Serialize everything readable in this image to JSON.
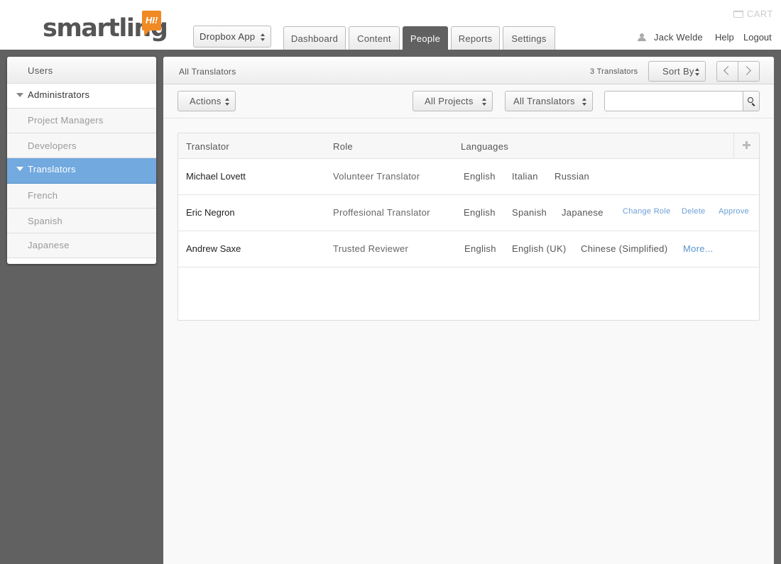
{
  "header": {
    "logo_text": "smartling",
    "logo_bubble": "HI!",
    "app_select": "Dropbox App",
    "tabs": [
      {
        "label": "Dashboard",
        "active": false
      },
      {
        "label": "Content",
        "active": false
      },
      {
        "label": "People",
        "active": true
      },
      {
        "label": "Reports",
        "active": false
      },
      {
        "label": "Settings",
        "active": false
      }
    ],
    "cart": "CART",
    "user_name": "Jack Welde",
    "help": "Help",
    "logout": "Logout"
  },
  "sidebar": {
    "items": [
      {
        "label": "Users"
      },
      {
        "label": "Administrators"
      },
      {
        "label": "Project Managers"
      },
      {
        "label": "Developers"
      },
      {
        "label": "Translators",
        "selected": true
      },
      {
        "label": "French"
      },
      {
        "label": "Spanish"
      },
      {
        "label": "Japanese"
      }
    ]
  },
  "main": {
    "title": "All Translators",
    "count": "3 Translators",
    "sort_by": "Sort By",
    "toolbar": {
      "actions": "Actions",
      "projects": "All Projects",
      "translators": "All Translators",
      "search_value": ""
    },
    "table": {
      "headers": [
        "Translator",
        "Role",
        "Languages"
      ],
      "rows": [
        {
          "name": "Michael Lovett",
          "role": "Volunteer Translator",
          "languages": [
            "English",
            "Italian",
            "Russian"
          ]
        },
        {
          "name": "Eric Negron",
          "role": "Proffesional Translator",
          "languages": [
            "English",
            "Spanish",
            "Japanese"
          ],
          "actions": [
            "Change Role",
            "Delete",
            "Approve"
          ]
        },
        {
          "name": "Andrew Saxe",
          "role": "Trusted Reviewer",
          "languages": [
            "English",
            "English (UK)",
            "Chinese (Simplified)"
          ],
          "more": "More..."
        }
      ]
    }
  },
  "colors": {
    "accent": "#72a9df",
    "brand_orange": "#f08a24",
    "link": "#6b9fd6",
    "backdrop": "#616161"
  }
}
